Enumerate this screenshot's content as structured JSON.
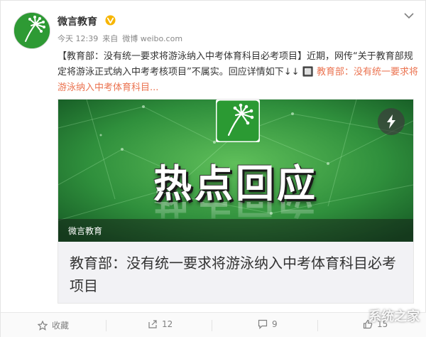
{
  "user": {
    "name": "微言教育"
  },
  "meta": {
    "time": "今天 12:39",
    "source_prefix": "来自",
    "source": "微博 weibo.com"
  },
  "post": {
    "text": "【教育部：没有统一要求将游泳纳入中考体育科目必考项目】近期，网传“关于教育部规定将游泳正式纳入中考考核项目”不属实。回应详情如下↓↓ ",
    "link": "🔲 教育部：没有统一要求将游泳纳入中考体育科目..."
  },
  "card": {
    "banner_title": "热点回应",
    "banner_footer": "微言教育",
    "title": "教育部：没有统一要求将游泳纳入中考体育科目必考项目"
  },
  "actions": {
    "favorite": "收藏",
    "repost": "12",
    "comment": "9",
    "like": "15"
  },
  "watermark": "系统之家",
  "colors": {
    "link": "#eb7350",
    "banner_green": "#2f8f3c",
    "verify": "#f7b500"
  },
  "icons": [
    "avatar-logo",
    "verified-icon",
    "chevron-down-icon",
    "bolt-icon",
    "star-icon",
    "repost-icon",
    "comment-icon",
    "like-icon"
  ]
}
